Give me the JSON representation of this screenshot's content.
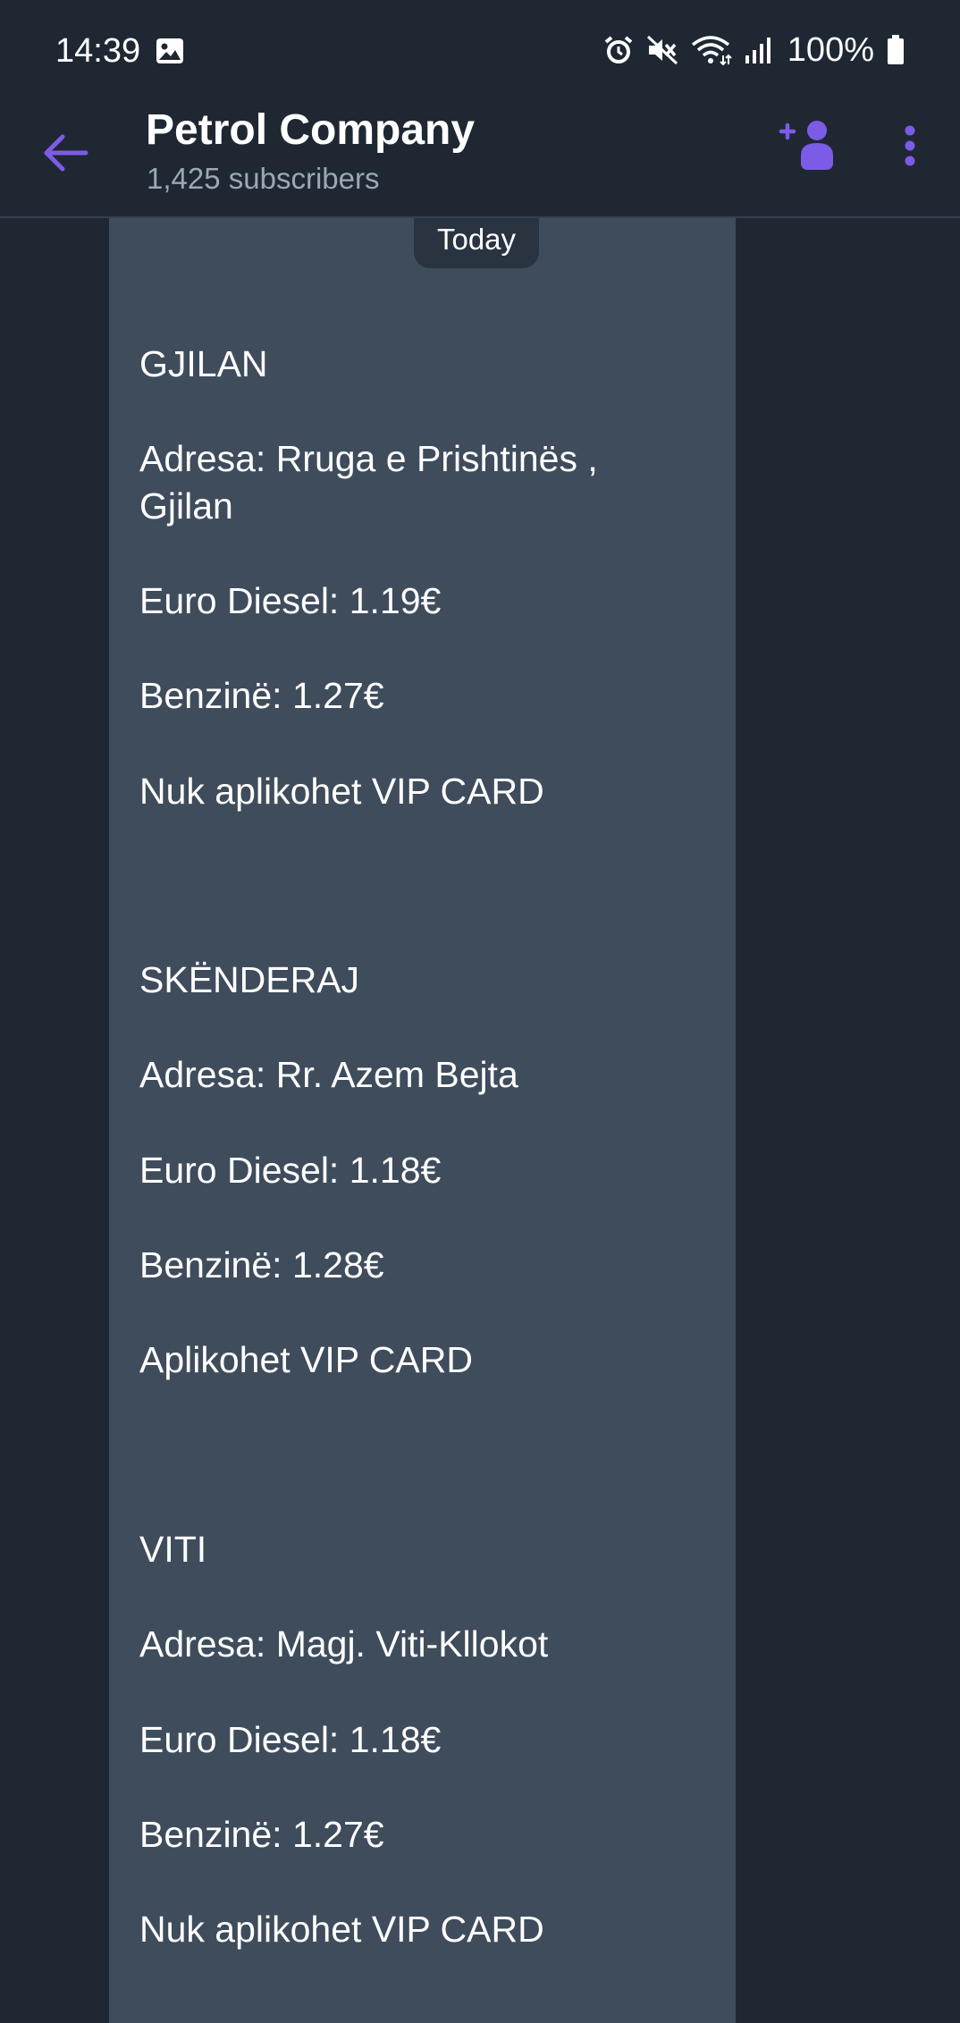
{
  "status_bar": {
    "time": "14:39",
    "battery": "100%",
    "icons": [
      "image-icon",
      "alarm-icon",
      "mute-icon",
      "wifi-icon",
      "signal-icon",
      "battery-icon"
    ]
  },
  "header": {
    "title": "Petrol Company",
    "subtitle": "1,425 subscribers",
    "back_icon": "arrow-left-icon",
    "add_icon": "add-person-icon",
    "menu_icon": "more-vertical-icon",
    "accent_color": "#7c5ce6"
  },
  "chat": {
    "date_label": "Today",
    "bubble_color": "#3f4c5c",
    "background_color": "#1f2733",
    "lines": [
      "GJILAN",
      "Adresa: Rruga e Prishtinës ,\nGjilan",
      "Euro Diesel: 1.19€",
      "Benzinë: 1.27€",
      "Nuk aplikohet VIP CARD",
      "SKËNDERAJ",
      "Adresa: Rr. Azem Bejta",
      "Euro Diesel: 1.18€",
      "Benzinë: 1.28€",
      "Aplikohet VIP CARD",
      "VITI",
      "Adresa: Magj. Viti-Kllokot",
      "Euro Diesel: 1.18€",
      "Benzinë: 1.27€",
      "Nuk aplikohet VIP CARD"
    ]
  }
}
